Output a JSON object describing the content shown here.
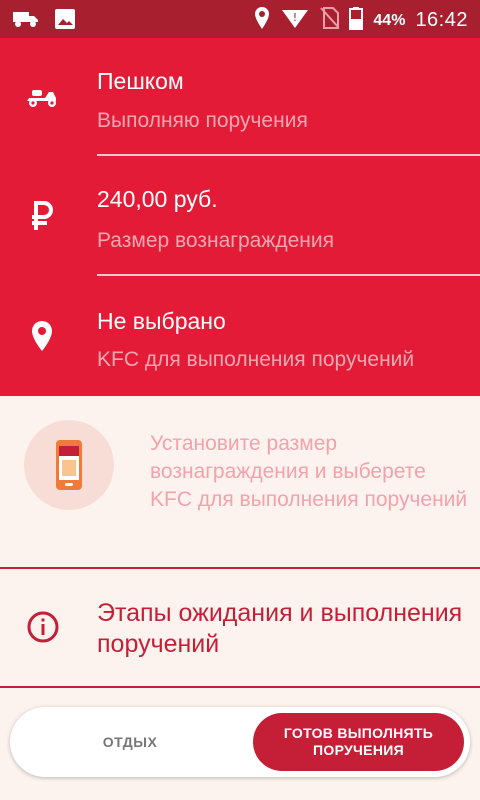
{
  "status_bar": {
    "battery": "44%",
    "time": "16:42",
    "icons": [
      "truck-icon",
      "image-icon",
      "location-icon",
      "wifi-icon",
      "no-sim-icon",
      "battery-icon"
    ]
  },
  "colors": {
    "status_bar": "#A8202F",
    "panel": "#E31B36",
    "accent": "#C51F38",
    "subtitle": "#F5A7B2",
    "background": "#FDF3EE"
  },
  "settings": {
    "mode": {
      "title": "Пешком",
      "subtitle": "Выполняю поручения",
      "icon": "scooter-icon"
    },
    "reward": {
      "title": "240,00 руб.",
      "subtitle": "Размер вознаграждения",
      "icon": "ruble-icon"
    },
    "restaurant": {
      "title": "Не выбрано",
      "subtitle": "KFC для выполнения поручений",
      "icon": "location-pin-icon"
    }
  },
  "hint": {
    "text": "Установите размер вознаграждения и выберете KFC для выполнения поручений",
    "icon": "phone-icon"
  },
  "stages": {
    "label": "Этапы ожидания и выполнения поручений",
    "icon": "info-icon"
  },
  "toggle": {
    "rest_label": "ОТДЫХ",
    "ready_label": "ГОТОВ ВЫПОЛНЯТЬ ПОРУЧЕНИЯ"
  }
}
